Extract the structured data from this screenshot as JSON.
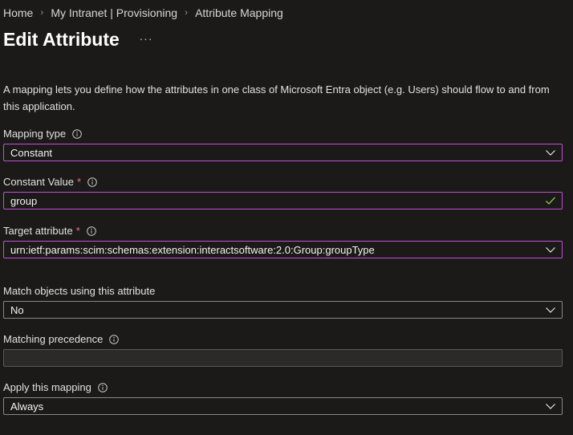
{
  "breadcrumb": {
    "items": [
      "Home",
      "My Intranet | Provisioning",
      "Attribute Mapping"
    ]
  },
  "header": {
    "title": "Edit Attribute",
    "more_label": "···"
  },
  "description": "A mapping lets you define how the attributes in one class of Microsoft Entra object (e.g. Users) should flow to and from this application.",
  "form": {
    "mapping_type": {
      "label": "Mapping type",
      "value": "Constant"
    },
    "constant_value": {
      "label": "Constant Value",
      "required_mark": "*",
      "value": "group"
    },
    "target_attribute": {
      "label": "Target attribute",
      "required_mark": "*",
      "value": "urn:ietf:params:scim:schemas:extension:interactsoftware:2.0:Group:groupType"
    },
    "match_objects": {
      "label": "Match objects using this attribute",
      "value": "No"
    },
    "matching_precedence": {
      "label": "Matching precedence",
      "value": ""
    },
    "apply_mapping": {
      "label": "Apply this mapping",
      "value": "Always"
    }
  },
  "colors": {
    "background": "#1b1a19",
    "focus_border": "#c34fd8",
    "border": "#8a8886",
    "required": "#f1707b",
    "valid_check": "#92c353"
  },
  "icons": {
    "info": "info-icon",
    "dropdown": "chevron-down-icon",
    "valid": "checkmark-icon",
    "more": "more-icon"
  }
}
